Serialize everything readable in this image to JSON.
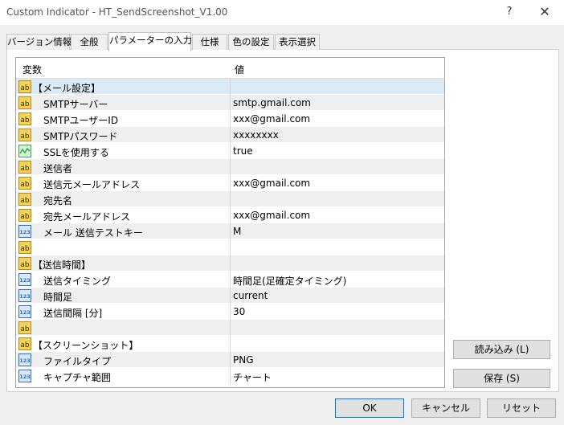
{
  "window": {
    "title": "Custom Indicator - HT_SendScreenshot_V1.00",
    "help_glyph": "?",
    "close_glyph": "✕"
  },
  "tabs": [
    {
      "label": "バージョン情報",
      "active": false
    },
    {
      "label": "全般",
      "active": false
    },
    {
      "label": "パラメーターの入力",
      "active": true
    },
    {
      "label": "仕様",
      "active": false
    },
    {
      "label": "色の設定",
      "active": false
    },
    {
      "label": "表示選択",
      "active": false
    }
  ],
  "grid": {
    "col_variable": "変数",
    "col_value": "値",
    "rows": [
      {
        "icon": "ab-icon",
        "name": "【メール設定】",
        "value": "",
        "indent": false
      },
      {
        "icon": "ab-icon",
        "name": "SMTPサーバー",
        "value": "smtp.gmail.com",
        "indent": true
      },
      {
        "icon": "ab-icon",
        "name": "SMTPユーザーID",
        "value": "xxx@gmail.com",
        "indent": true
      },
      {
        "icon": "ab-icon",
        "name": "SMTPパスワード",
        "value": "xxxxxxxx",
        "indent": true
      },
      {
        "icon": "bool-icon",
        "name": "SSLを使用する",
        "value": "true",
        "indent": true
      },
      {
        "icon": "ab-icon",
        "name": "送信者",
        "value": "",
        "indent": true
      },
      {
        "icon": "ab-icon",
        "name": "送信元メールアドレス",
        "value": "xxx@gmail.com",
        "indent": true
      },
      {
        "icon": "ab-icon",
        "name": "宛先名",
        "value": "",
        "indent": true
      },
      {
        "icon": "ab-icon",
        "name": "宛先メールアドレス",
        "value": "xxx@gmail.com",
        "indent": true
      },
      {
        "icon": "num-icon",
        "name": "メール 送信テストキー",
        "value": "M",
        "indent": true
      },
      {
        "icon": "ab-icon",
        "name": "",
        "value": "",
        "indent": false
      },
      {
        "icon": "ab-icon",
        "name": "【送信時間】",
        "value": "",
        "indent": false
      },
      {
        "icon": "num-icon",
        "name": "送信タイミング",
        "value": "時間足(足確定タイミング)",
        "indent": true
      },
      {
        "icon": "num-icon",
        "name": "時間足",
        "value": "current",
        "indent": true
      },
      {
        "icon": "num-icon",
        "name": "送信間隔 [分]",
        "value": "30",
        "indent": true
      },
      {
        "icon": "ab-icon",
        "name": "",
        "value": "",
        "indent": false
      },
      {
        "icon": "ab-icon",
        "name": "【スクリーンショット】",
        "value": "",
        "indent": false
      },
      {
        "icon": "num-icon",
        "name": "ファイルタイプ",
        "value": "PNG",
        "indent": true
      },
      {
        "icon": "num-icon",
        "name": "キャプチャ範囲",
        "value": "チャート",
        "indent": true
      }
    ]
  },
  "icon_labels": {
    "ab": "ab",
    "num": "123"
  },
  "buttons": {
    "load": "読み込み (L)",
    "save": "保存 (S)",
    "ok": "OK",
    "cancel": "キャンセル",
    "reset": "リセット"
  },
  "colors": {
    "selection": "#dbeaf7",
    "alt_row": "#efefef",
    "ab_icon": "#f4d35a",
    "num_icon": "#2f6fc8",
    "bool_icon": "#3aa84a"
  }
}
